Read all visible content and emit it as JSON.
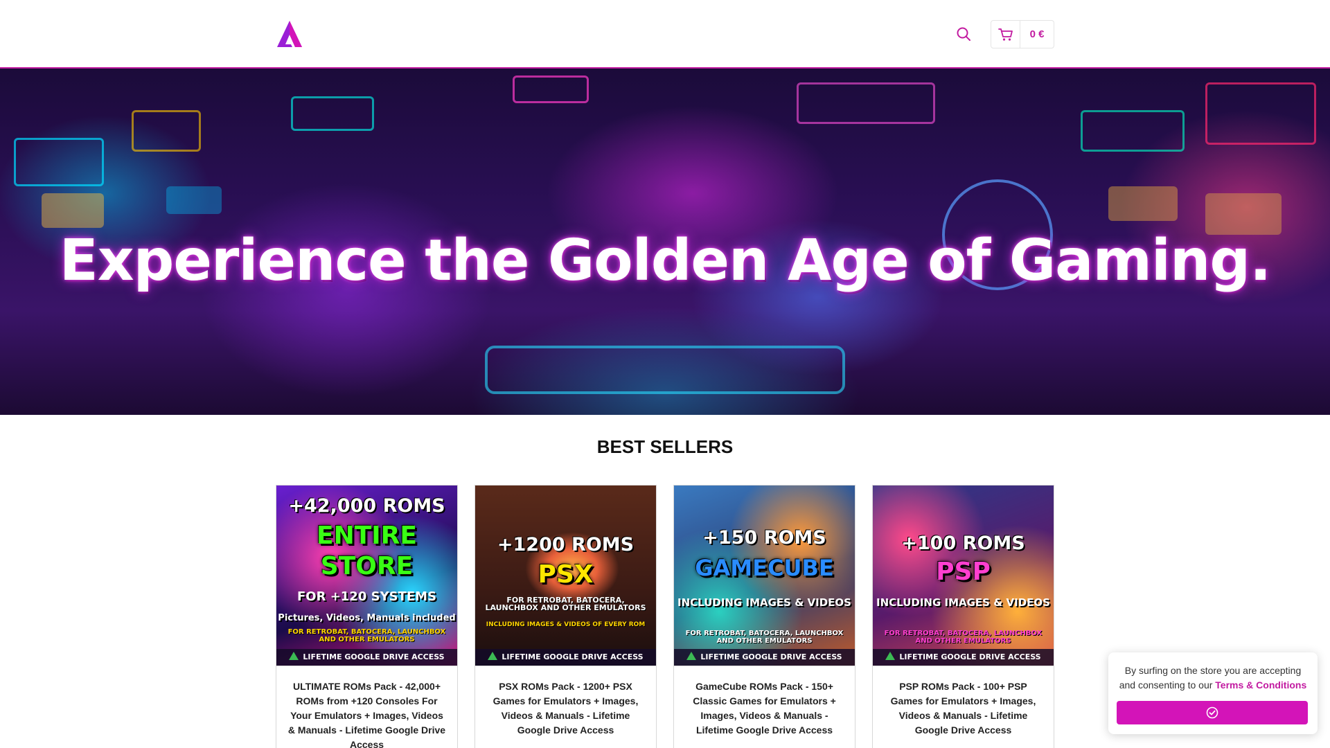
{
  "header": {
    "logo_icon": "store-logo-triangle",
    "search_icon": "search-icon",
    "cart_icon": "cart-icon",
    "cart_total": "0 €",
    "accent_color": "#c21aa0"
  },
  "hero": {
    "title": "Experience the Golden Age of Gaming."
  },
  "best_sellers": {
    "title": "BEST SELLERS",
    "products": [
      {
        "title": "ULTIMATE ROMs Pack - 42,000+ ROMs from +120 Consoles For Your Emulators + Images, Videos & Manuals - Lifetime Google Drive Access",
        "poster": {
          "top": "+42,000 ROMS",
          "big1": "ENTIRE",
          "big2": "STORE",
          "mid": "FOR +120 SYSTEMS",
          "line": "Pictures, Videos, Manuals included",
          "small": "FOR RETROBAT, BATOCERA, LAUNCHBOX AND OTHER EMULATORS",
          "bar": "LIFETIME GOOGLE DRIVE ACCESS"
        }
      },
      {
        "title": "PSX ROMs Pack - 1200+ PSX Games for Emulators + Images, Videos & Manuals - Lifetime Google Drive Access",
        "poster": {
          "top": "+1200 ROMS",
          "big1": "PSX",
          "small": "FOR RETROBAT, BATOCERA, LAUNCHBOX AND OTHER EMULATORS",
          "line": "INCLUDING IMAGES & VIDEOS OF EVERY ROM",
          "bar": "LIFETIME GOOGLE DRIVE ACCESS"
        }
      },
      {
        "title": "GameCube ROMs Pack - 150+ Classic Games for Emulators + Images, Videos & Manuals - Lifetime Google Drive Access",
        "poster": {
          "top": "+150 ROMS",
          "big1": "GAMECUBE",
          "mid": "INCLUDING IMAGES & VIDEOS",
          "small": "FOR RETROBAT, BATOCERA, LAUNCHBOX AND OTHER EMULATORS",
          "bar": "LIFETIME GOOGLE DRIVE ACCESS"
        }
      },
      {
        "title": "PSP ROMs Pack - 100+ PSP Games for Emulators + Images, Videos & Manuals - Lifetime Google Drive Access",
        "poster": {
          "top": "+100 ROMS",
          "big1": "PSP",
          "mid": "INCLUDING IMAGES & VIDEOS",
          "small": "FOR RETROBAT, BATOCERA, LAUNCHBOX AND OTHER EMULATORS",
          "bar": "LIFETIME GOOGLE DRIVE ACCESS"
        }
      }
    ]
  },
  "cookie_banner": {
    "text": "By surfing on the store you are accepting and consenting to our",
    "link": "Terms & Conditions",
    "accept_icon": "check-badge-icon",
    "button_color": "#d314b8"
  }
}
